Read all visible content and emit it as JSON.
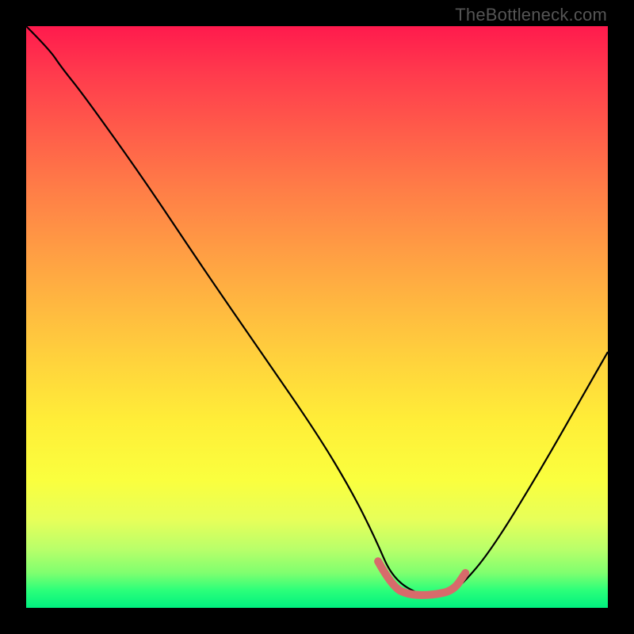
{
  "watermark": "TheBottleneck.com",
  "chart_data": {
    "type": "line",
    "title": "",
    "xlabel": "",
    "ylabel": "",
    "xlim": [
      0,
      100
    ],
    "ylim": [
      0,
      100
    ],
    "grid": false,
    "description": "Black curve on red-yellow-green vertical gradient background, V-shape with minimum plateau ~x 62-74, short pink overlay segment near minimum.",
    "series": [
      {
        "name": "main-curve",
        "color": "#000000",
        "x": [
          0,
          4,
          6,
          10,
          20,
          30,
          40,
          50,
          56,
          60,
          63,
          68,
          72,
          75,
          80,
          88,
          96,
          100
        ],
        "y": [
          100,
          96,
          93,
          88,
          74,
          59,
          44.5,
          30,
          20,
          12,
          5,
          2,
          2,
          4,
          10,
          23,
          37,
          44
        ]
      },
      {
        "name": "highlight-range",
        "color": "#d76b6b",
        "x": [
          60.5,
          63,
          66,
          70,
          73.5,
          75.5
        ],
        "y": [
          8,
          3.5,
          2.2,
          2.2,
          3,
          6
        ]
      }
    ]
  }
}
